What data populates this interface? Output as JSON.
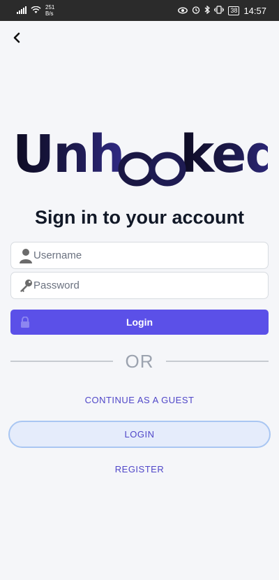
{
  "status_bar": {
    "speed_value": "251",
    "speed_unit": "B/s",
    "battery": "38",
    "time": "14:57"
  },
  "logo": {
    "text": "Unhooked"
  },
  "page_title": "Sign in to your account",
  "username": {
    "placeholder": "Username",
    "value": ""
  },
  "password": {
    "placeholder": "Password",
    "value": ""
  },
  "login_button": "Login",
  "divider_text": "OR",
  "guest_link": "CONTINUE AS A GUEST",
  "login_secondary": "LOGIN",
  "register_link": "REGISTER",
  "colors": {
    "primary": "#5b50e8",
    "link": "#4f46c8",
    "logo_dark": "#0d0b22",
    "logo_accent": "#2f2a7a"
  }
}
